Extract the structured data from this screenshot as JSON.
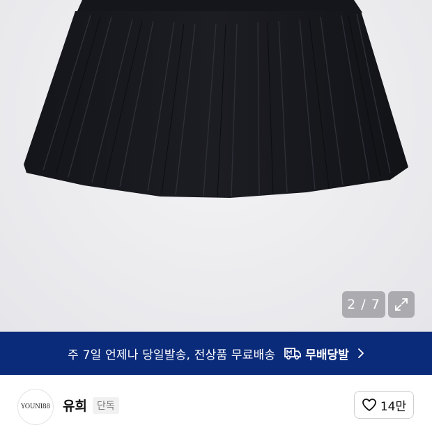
{
  "gallery": {
    "page_indicator": "2 / 7",
    "expand_icon": "expand-icon"
  },
  "banner": {
    "text": "주 7일 언제나 당일발송, 전상품 무료배송",
    "badge_label": "무배당발",
    "badge_icon": "delivery-truck-icon",
    "arrow_icon": "chevron-right-icon",
    "background": "#0a2a7a"
  },
  "shop": {
    "logo_text": "YOUNI88",
    "name": "유희",
    "tag": "단독",
    "like_icon": "heart-icon",
    "like_count": "14만"
  }
}
